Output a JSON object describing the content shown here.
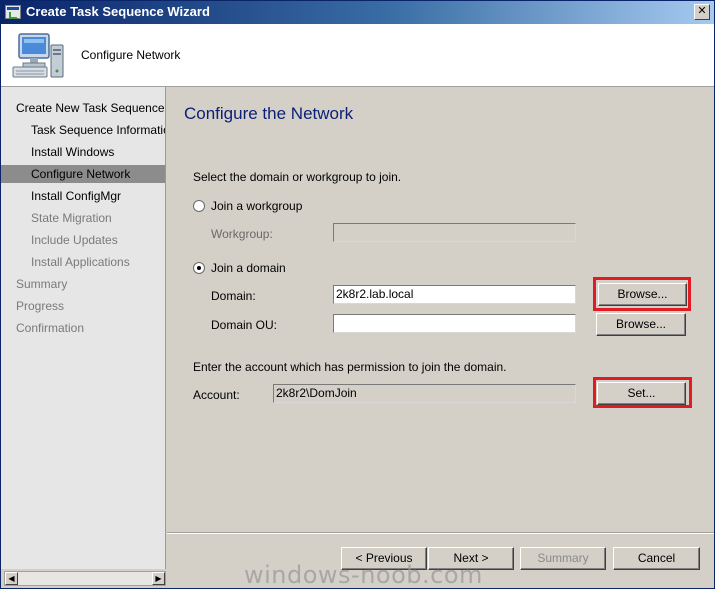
{
  "window": {
    "title": "Create Task Sequence Wizard",
    "close_glyph": "✕"
  },
  "header": {
    "icon": "computer-icon",
    "title": "Configure Network"
  },
  "nav": {
    "items": [
      {
        "label": "Create New Task Sequence",
        "state": "normal"
      },
      {
        "label": "Task Sequence Information",
        "state": "normal"
      },
      {
        "label": "Install Windows",
        "state": "normal"
      },
      {
        "label": "Configure Network",
        "state": "active"
      },
      {
        "label": "Install ConfigMgr",
        "state": "normal"
      },
      {
        "label": "State Migration",
        "state": "dim"
      },
      {
        "label": "Include Updates",
        "state": "dim"
      },
      {
        "label": "Install Applications",
        "state": "dim"
      },
      {
        "label": "Summary",
        "state": "dim"
      },
      {
        "label": "Progress",
        "state": "dim"
      },
      {
        "label": "Confirmation",
        "state": "dim"
      }
    ],
    "scroll_left": "◀",
    "scroll_right": "▶"
  },
  "main": {
    "page_title": "Configure the Network",
    "instruction": "Select the domain or workgroup to join.",
    "workgroup_radio": {
      "label": "Join a workgroup",
      "checked": false
    },
    "workgroup_label": "Workgroup:",
    "workgroup_value": "",
    "domain_radio": {
      "label": "Join a domain",
      "checked": true
    },
    "domain_label": "Domain:",
    "domain_value": "2k8r2.lab.local",
    "domain_browse": "Browse...",
    "domain_ou_label": "Domain OU:",
    "domain_ou_value": "",
    "domain_ou_browse": "Browse...",
    "account_instruction": "Enter the account which has permission to join the domain.",
    "account_label": "Account:",
    "account_value": "2k8r2\\DomJoin",
    "set_button": "Set..."
  },
  "footer": {
    "previous": "< Previous",
    "next": "Next >",
    "summary": "Summary",
    "cancel": "Cancel"
  },
  "annotation": {
    "highlight_color": "#e01b24"
  },
  "watermark": "windows-noob.com"
}
